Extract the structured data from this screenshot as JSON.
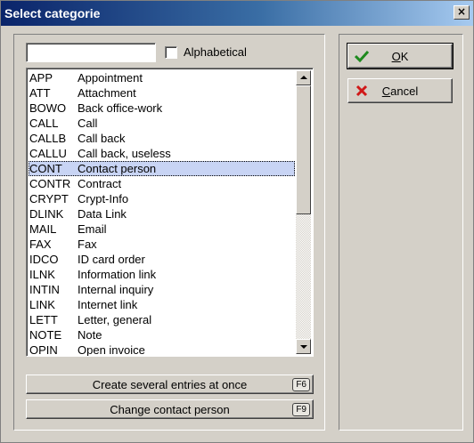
{
  "window": {
    "title": "Select categorie",
    "close_glyph": "×"
  },
  "filter": {
    "search_value": "",
    "alphabetical_label": "Alphabetical",
    "alphabetical_checked": false
  },
  "list": {
    "selected_index": 6,
    "items": [
      {
        "code": "APP",
        "label": "Appointment"
      },
      {
        "code": "ATT",
        "label": "Attachment"
      },
      {
        "code": "BOWO",
        "label": "Back office-work"
      },
      {
        "code": "CALL",
        "label": "Call"
      },
      {
        "code": "CALLB",
        "label": "Call back"
      },
      {
        "code": "CALLU",
        "label": "Call back, useless"
      },
      {
        "code": "CONT",
        "label": "Contact person"
      },
      {
        "code": "CONTR",
        "label": "Contract"
      },
      {
        "code": "CRYPT",
        "label": "Crypt-Info"
      },
      {
        "code": "DLINK",
        "label": "Data Link"
      },
      {
        "code": "MAIL",
        "label": "Email"
      },
      {
        "code": "FAX",
        "label": "Fax"
      },
      {
        "code": "IDCO",
        "label": "ID card order"
      },
      {
        "code": "ILNK",
        "label": "Information link"
      },
      {
        "code": "INTIN",
        "label": "Internal inquiry"
      },
      {
        "code": "LINK",
        "label": "Internet link"
      },
      {
        "code": "LETT",
        "label": "Letter, general"
      },
      {
        "code": "NOTE",
        "label": "Note"
      },
      {
        "code": "OPIN",
        "label": "Open invoice"
      }
    ]
  },
  "buttons": {
    "several_entries": {
      "label": "Create several entries at once",
      "key": "F6"
    },
    "change_contact": {
      "label": "Change contact person",
      "key": "F9"
    },
    "ok": {
      "mnemonic": "O",
      "rest": "K",
      "icon": "checkmark-icon"
    },
    "cancel": {
      "mnemonic": "C",
      "rest": "ancel",
      "icon": "cross-icon"
    }
  },
  "colors": {
    "selection": "#c8d4f4",
    "ok_icon": "#1e8a1e",
    "cancel_icon": "#d01818"
  }
}
